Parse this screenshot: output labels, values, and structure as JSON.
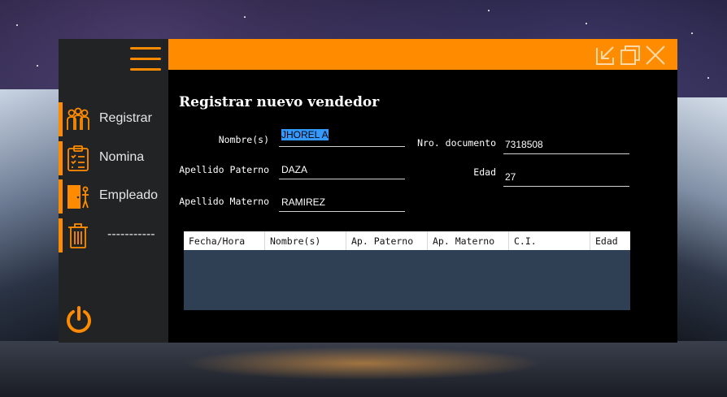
{
  "sidebar": {
    "items": [
      {
        "label": "Registrar",
        "icon": "team-icon"
      },
      {
        "label": "Nomina",
        "icon": "clipboard-list-icon"
      },
      {
        "label": "Empleado",
        "icon": "exit-door-icon"
      },
      {
        "label": "-----------",
        "icon": "trash-icon"
      }
    ],
    "accent": "#ff8c00"
  },
  "form": {
    "title": "Registrar nuevo vendedor",
    "nombre_label": "Nombre(s)",
    "nombre_value": "JHOREL A",
    "paterno_label": "Apellido Paterno",
    "paterno_value": "DAZA",
    "materno_label": "Apellido Materno",
    "materno_value": "RAMIREZ",
    "documento_label": "Nro. documento",
    "documento_value": "7318508",
    "edad_label": "Edad",
    "edad_value": "27"
  },
  "table": {
    "columns": [
      "Fecha/Hora",
      "Nombre(s)",
      "Ap. Paterno",
      "Ap. Materno",
      "C.I.",
      "Edad"
    ],
    "rows": []
  }
}
